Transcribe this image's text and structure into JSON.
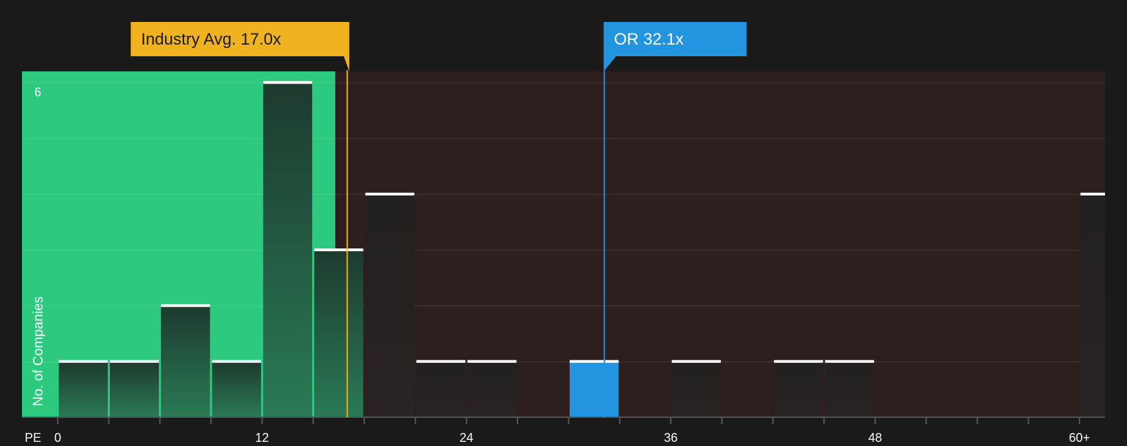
{
  "chart_data": {
    "type": "bar",
    "xlabel": "PE",
    "ylabel": "No. of Companies",
    "x_tick_labels": [
      "0",
      "12",
      "24",
      "36",
      "48",
      "60+"
    ],
    "x_tick_values": [
      0,
      12,
      24,
      36,
      48,
      60
    ],
    "y_tick_labels": [
      "6"
    ],
    "y_tick_values": [
      6
    ],
    "ylim": [
      0,
      6.2
    ],
    "xlim": [
      -2.1,
      61.5
    ],
    "bin_width": 3,
    "bins": [
      {
        "start": 0,
        "end": 3,
        "count": 1
      },
      {
        "start": 3,
        "end": 6,
        "count": 1
      },
      {
        "start": 6,
        "end": 9,
        "count": 2
      },
      {
        "start": 9,
        "end": 12,
        "count": 1
      },
      {
        "start": 12,
        "end": 15,
        "count": 6
      },
      {
        "start": 15,
        "end": 18,
        "count": 3
      },
      {
        "start": 18,
        "end": 21,
        "count": 4
      },
      {
        "start": 21,
        "end": 24,
        "count": 1
      },
      {
        "start": 24,
        "end": 27,
        "count": 1
      },
      {
        "start": 30,
        "end": 33,
        "count": 1,
        "highlight": true
      },
      {
        "start": 36,
        "end": 39,
        "count": 1
      },
      {
        "start": 42,
        "end": 45,
        "count": 1
      },
      {
        "start": 45,
        "end": 48,
        "count": 1
      },
      {
        "start": 60,
        "end": 63,
        "count": 4
      }
    ],
    "markers": [
      {
        "label": "Industry Avg. 17.0x",
        "value": 17.0,
        "role": "industry"
      },
      {
        "label": "OR 32.1x",
        "value": 32.1,
        "role": "company"
      }
    ],
    "fair_value_zone_end": 16.3,
    "grid": true,
    "colors": {
      "background": "#1a1a1a",
      "undervalued_zone": "#2dc97e",
      "overvalued_zone": "#2e1f1f",
      "industry_marker": "#f0b21e",
      "company_marker": "#2394e0",
      "bar_fill": "#232323",
      "bar_top": "#ffffff",
      "grid": "#4a3b3b"
    }
  }
}
